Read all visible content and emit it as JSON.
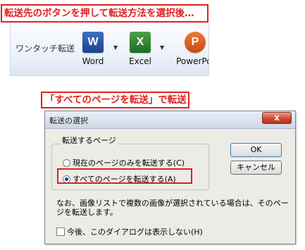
{
  "callouts": {
    "step1": "転送先のボタンを押して転送方法を選択後…",
    "step2": "「すべてのページを転送」で転送"
  },
  "ribbon": {
    "group_label": "ワンタッチ転送",
    "buttons": [
      {
        "label": "Word",
        "icon": "word-icon",
        "glyph": "W",
        "color": "#2b579a"
      },
      {
        "label": "Excel",
        "icon": "excel-icon",
        "glyph": "X",
        "color": "#217346"
      },
      {
        "label": "PowerPoi",
        "icon": "powerpoint-icon",
        "glyph": "P",
        "color": "#d24726"
      }
    ],
    "dropdown_glyph": "▼"
  },
  "dialog": {
    "title": "転送の選択",
    "close": "x",
    "group_label": "転送するページ",
    "options": [
      {
        "label": "現在のページのみを転送する(C)",
        "selected": false
      },
      {
        "label": "すべてのページを転送する(A)",
        "selected": true
      }
    ],
    "ok": "OK",
    "cancel": "キャンセル",
    "note": "なお、画像リストで複数の画像が選択されている場合は、そのページを転送します。",
    "checkbox": {
      "label": "今後、このダイアログは表示しない(H)",
      "checked": false
    }
  },
  "colors": {
    "accent": "#e02020"
  }
}
